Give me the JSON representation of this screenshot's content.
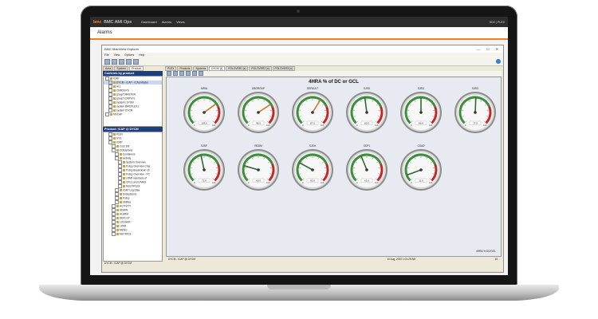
{
  "header": {
    "logo": "bmc",
    "product": "BMC AMI Ops",
    "nav": [
      "Dashboard",
      "Alarms",
      "Views"
    ],
    "user": "SDC | PLEX",
    "user_sub": "Signed in as"
  },
  "page_title": "Alarms",
  "window": {
    "title": "BMC MainView Explorer",
    "menu": [
      "File",
      "View",
      "Options",
      "Help"
    ]
  },
  "left": {
    "tabs": [
      "Area",
      "System",
      "Product"
    ],
    "contents_title": "Contents by product",
    "contents_items": [
      {
        "label": "ICAP",
        "level": 0,
        "selected": false
      },
      {
        "label": "DYCM - ICAP - ICAp Master",
        "level": 1,
        "selected": true
      },
      {
        "label": "ALL",
        "level": 1,
        "selected": false
      },
      {
        "label": "CMRSSYS",
        "level": 1,
        "selected": false
      },
      {
        "label": "groupT.MASTER.",
        "level": 1,
        "selected": false
      },
      {
        "label": "groupT.CMPSYL",
        "level": 1,
        "selected": false
      },
      {
        "label": "systems SYSM",
        "level": 1,
        "selected": false
      },
      {
        "label": "system BMCPLEX1",
        "level": 1,
        "selected": false
      },
      {
        "label": "system DYCM",
        "level": 1,
        "selected": false
      },
      {
        "label": "MVCAP",
        "level": 0,
        "selected": false
      }
    ],
    "product_title": "Product: ICAP @ DYCM",
    "product_items": [
      {
        "label": "PLEX",
        "level": 1
      },
      {
        "label": "SYS",
        "level": 1
      },
      {
        "label": "ICAP",
        "level": 1
      },
      {
        "label": "Cost Sht",
        "level": 2
      },
      {
        "label": "CDExplorer",
        "level": 2
      },
      {
        "label": "Containers",
        "level": 3
      },
      {
        "label": "Activity",
        "level": 3
      },
      {
        "label": "System Overview",
        "level": 4
      },
      {
        "label": "Policy Overview Char",
        "level": 4
      },
      {
        "label": "Policy Breakdown Ch",
        "level": 4
      },
      {
        "label": "Policy Overview - PC",
        "level": 4
      },
      {
        "label": "LPAR members of",
        "level": 4
      },
      {
        "label": "CPCs and LPARs",
        "level": 4
      },
      {
        "label": "MULTIPLEX",
        "level": 4
      },
      {
        "label": "ICAP Log Data",
        "level": 3
      },
      {
        "label": "Subsystems",
        "level": 3
      },
      {
        "label": "Policy",
        "level": 3
      },
      {
        "label": "Utilities",
        "level": 3
      },
      {
        "label": "ACTIVITY",
        "level": 2
      },
      {
        "label": "ADMIN",
        "level": 2
      },
      {
        "label": "ALARM",
        "level": 2
      },
      {
        "label": "DEPLOY",
        "level": 2
      },
      {
        "label": "LOGGER",
        "level": 2
      },
      {
        "label": "LPAR",
        "level": 2
      },
      {
        "label": "MENU",
        "level": 2
      },
      {
        "label": "METRICS",
        "level": 2
      }
    ],
    "status": "DYCM - ICAP @ DYCM"
  },
  "right": {
    "tabs": [
      "PLEX",
      "Products",
      "Systems",
      "DYCM [x]",
      "POLOVER1 [x]",
      "POLOVER2 [x]",
      "POLOVER3 [x]"
    ],
    "active_tab": 3,
    "dashboard_title": "4HRA % of DC or GCL",
    "legend": "4HRA % DC/GCL",
    "status_date": "10 Aug, 2020 1:01:25 AM",
    "status_count": "15",
    "gauges": [
      {
        "label": "MRIA",
        "value": 77,
        "display": "103.0",
        "min": "0",
        "max": "110"
      },
      {
        "label": "DBGROUP",
        "value": 78,
        "display": "98.0",
        "min": "0",
        "max": "110"
      },
      {
        "label": "DEFAULT",
        "value": 68,
        "display": "87.0",
        "min": "0",
        "max": "110"
      },
      {
        "label": "SJSD",
        "value": 52,
        "display": "60.5",
        "min": "0",
        "max": "110"
      },
      {
        "label": "SJSG",
        "value": 55,
        "display": "66.6",
        "min": "0",
        "max": "110"
      },
      {
        "label": "SJSO",
        "value": 56,
        "display": "77.0",
        "min": "0",
        "max": "110"
      },
      {
        "label": "SJSF",
        "value": 50,
        "display": "71.0",
        "min": "0",
        "max": "110"
      },
      {
        "label": "RDDM",
        "value": 25,
        "display": "60.0",
        "min": "0",
        "max": "110"
      },
      {
        "label": "SJSH",
        "value": 30,
        "display": "82.0",
        "min": "0",
        "max": "110"
      },
      {
        "label": "SCP1",
        "value": 46,
        "display": "63.0",
        "min": "0",
        "max": "110"
      },
      {
        "label": "CSAD",
        "value": 10,
        "display": "11.0",
        "min": "0",
        "max": "110"
      }
    ]
  }
}
